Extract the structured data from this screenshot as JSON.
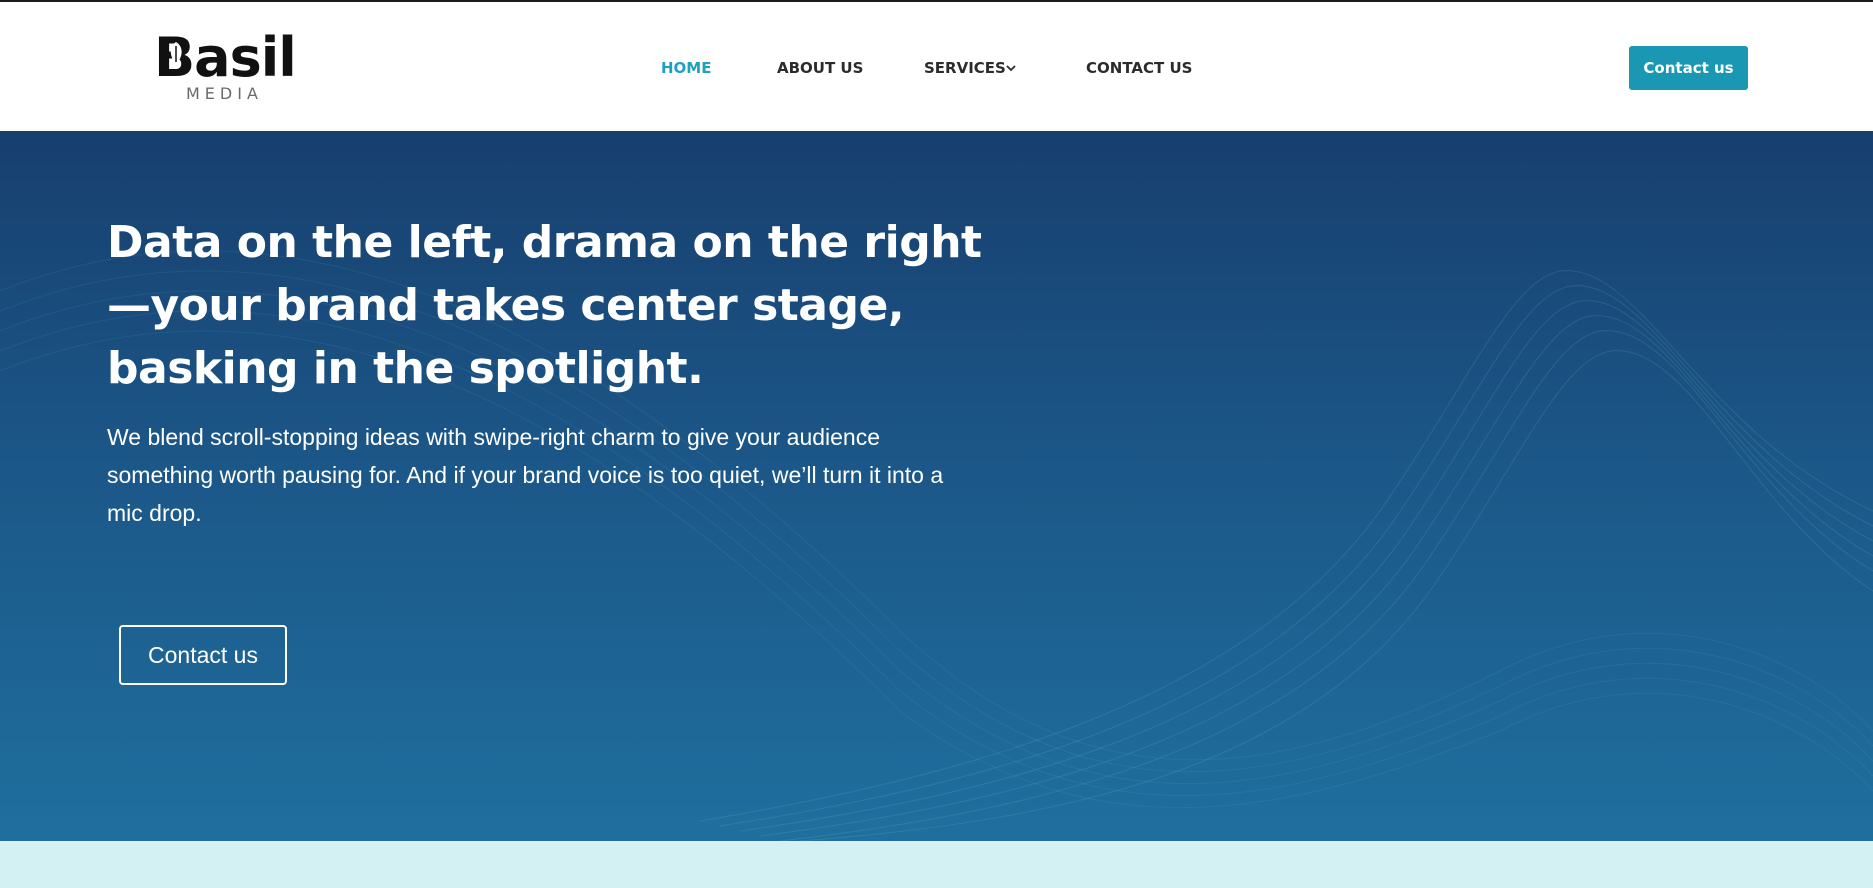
{
  "brand": {
    "logo_word": "Basil",
    "logo_sub": "MEDIA"
  },
  "nav": {
    "items": [
      {
        "label": "HOME",
        "active": true
      },
      {
        "label": "ABOUT US",
        "active": false
      },
      {
        "label": "SERVICES",
        "active": false,
        "has_dropdown": true
      },
      {
        "label": "CONTACT US",
        "active": false
      }
    ]
  },
  "header": {
    "cta_label": "Contact us"
  },
  "hero": {
    "title": "Data on the left, drama on the right—your brand takes center stage, basking in the spotlight.",
    "body": "We blend scroll-stopping ideas with swipe-right charm to give your audience something worth pausing for. And if your brand voice is too quiet, we’ll turn it into a mic drop.",
    "cta_label": "Contact us"
  },
  "colors": {
    "accent": "#1a98b3",
    "nav_active": "#1fa0bd",
    "hero_top": "#173f6e",
    "hero_bottom": "#1f6f9e",
    "band": "#d3f1f3"
  },
  "icons": {
    "logo_leaf": "leaf-icon",
    "services_dropdown": "chevron-down-icon"
  }
}
